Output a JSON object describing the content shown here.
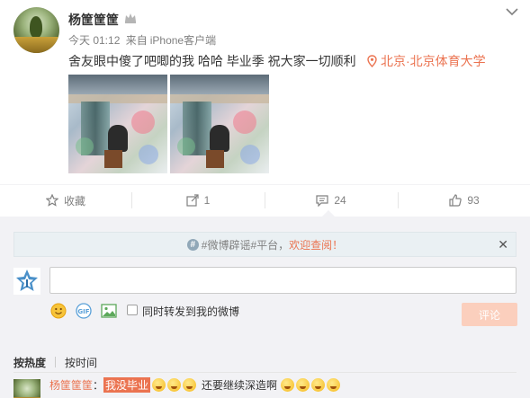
{
  "post": {
    "username": "杨筐筐筐",
    "time": "今天 01:12",
    "source_prefix": "来自",
    "source": "iPhone客户端",
    "content": "舍友眼中傻了吧唧的我 哈哈 毕业季 祝大家一切顺利",
    "location": "北京·北京体育大学",
    "photos": [
      {
        "alt": "photo-1"
      },
      {
        "alt": "photo-2"
      }
    ]
  },
  "actions": {
    "favorite_label": "收藏",
    "repost_count": "1",
    "comment_count": "24",
    "like_count": "93"
  },
  "notice": {
    "tag": "#微博辟谣#平台",
    "separator": "，",
    "link": "欢迎查阅！",
    "close": "✕"
  },
  "composer": {
    "input_value": "",
    "input_placeholder": "",
    "forward_label": "同时转发到我的微博",
    "submit_label": "评论",
    "tools": [
      "emoji-icon",
      "gif-icon",
      "image-icon"
    ]
  },
  "sort": {
    "hot_label": "按热度",
    "time_label": "按时间"
  },
  "comments": [
    {
      "user": "杨筐筐筐",
      "colon": "：",
      "highlight": "我没毕业",
      "text": "还要继续深造啊"
    }
  ],
  "colors": {
    "accent": "#eb7350",
    "submit_bg": "#fbcfbd",
    "comment_bg": "#f2f2f5"
  }
}
